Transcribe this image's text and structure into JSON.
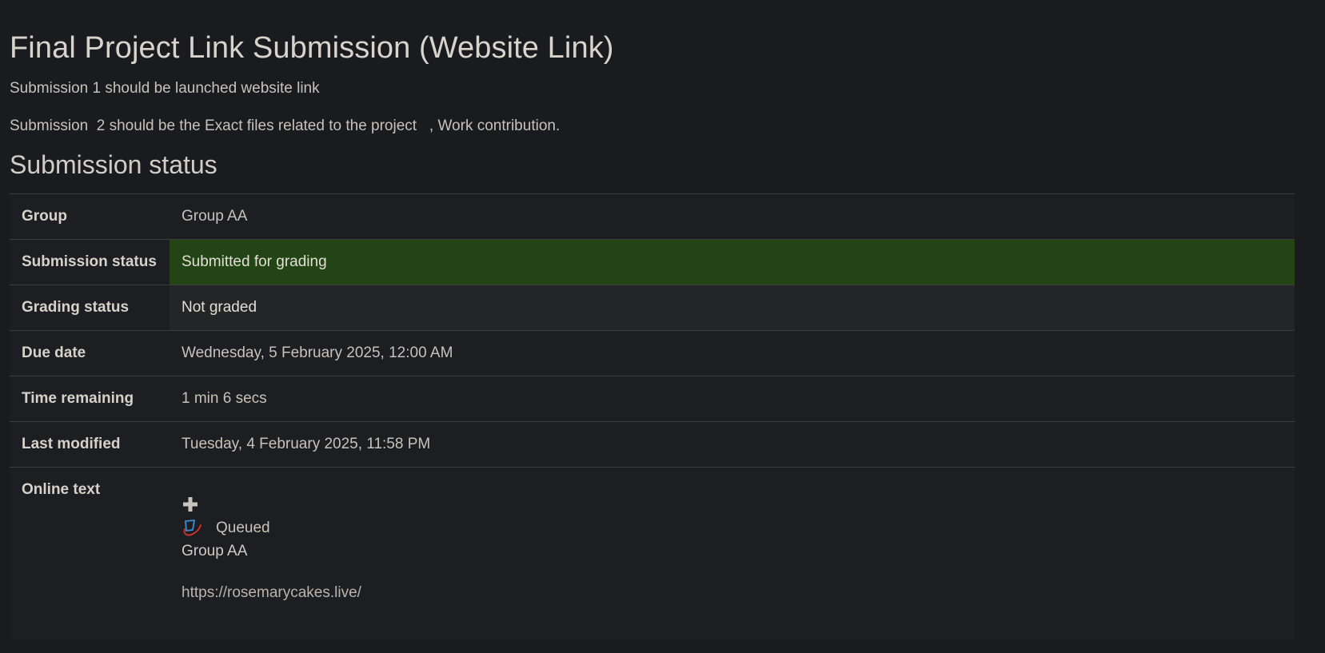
{
  "page": {
    "title": "Final Project Link Submission (Website Link)",
    "intro": [
      "Submission 1 should be launched website link",
      "Submission  2 should be the Exact files related to the project   , Work contribution."
    ]
  },
  "status_section": {
    "heading": "Submission status",
    "rows": {
      "group": {
        "label": "Group",
        "value": "Group AA"
      },
      "submission_status": {
        "label": "Submission status",
        "value": "Submitted for grading"
      },
      "grading_status": {
        "label": "Grading status",
        "value": "Not graded"
      },
      "due_date": {
        "label": "Due date",
        "value": "Wednesday, 5 February 2025, 12:00 AM"
      },
      "time_remaining": {
        "label": "Time remaining",
        "value": "1 min 6 secs"
      },
      "last_modified": {
        "label": "Last modified",
        "value": "Tuesday, 4 February 2025, 11:58 PM"
      },
      "online_text": {
        "label": "Online text",
        "plagiarism_status": "Queued",
        "group_text": "Group AA",
        "link_text": "https://rosemarycakes.live/"
      }
    }
  },
  "icons": {
    "expand": "plus-icon",
    "plagiarism": "document-check-icon"
  },
  "colors": {
    "background": "#1a1b1e",
    "submitted_row": "#234516",
    "grading_row": "#232527"
  }
}
